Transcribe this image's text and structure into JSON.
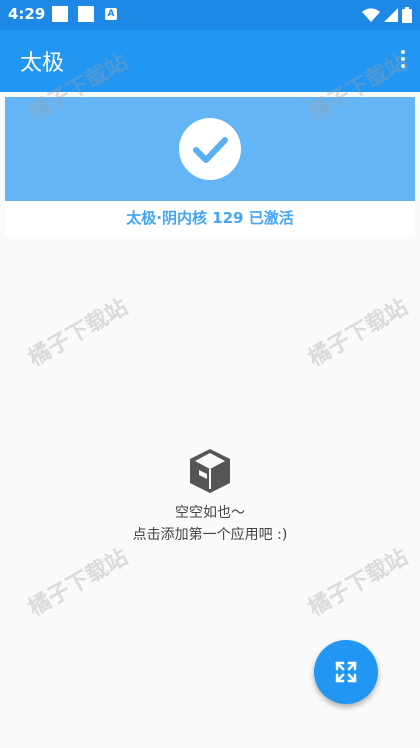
{
  "status_bar": {
    "time": "4:29",
    "notification_letter": "A"
  },
  "app_bar": {
    "title": "太极"
  },
  "status_card": {
    "text": "太极·阴内核 129 已激活"
  },
  "empty_state": {
    "line1": "空空如也～",
    "line2": "点击添加第一个应用吧 :)"
  },
  "watermark": {
    "text": "橘子下载站"
  },
  "colors": {
    "status_bar": "#1e88e5",
    "app_bar": "#2196f3",
    "card_header": "#64b5f6",
    "accent_text": "#42a5f5",
    "fab": "#2196f3",
    "background": "#fafafa"
  },
  "icons": {
    "check": "check-icon",
    "empty": "box-icon",
    "fab": "expand-icon",
    "menu": "more-vert-icon"
  }
}
